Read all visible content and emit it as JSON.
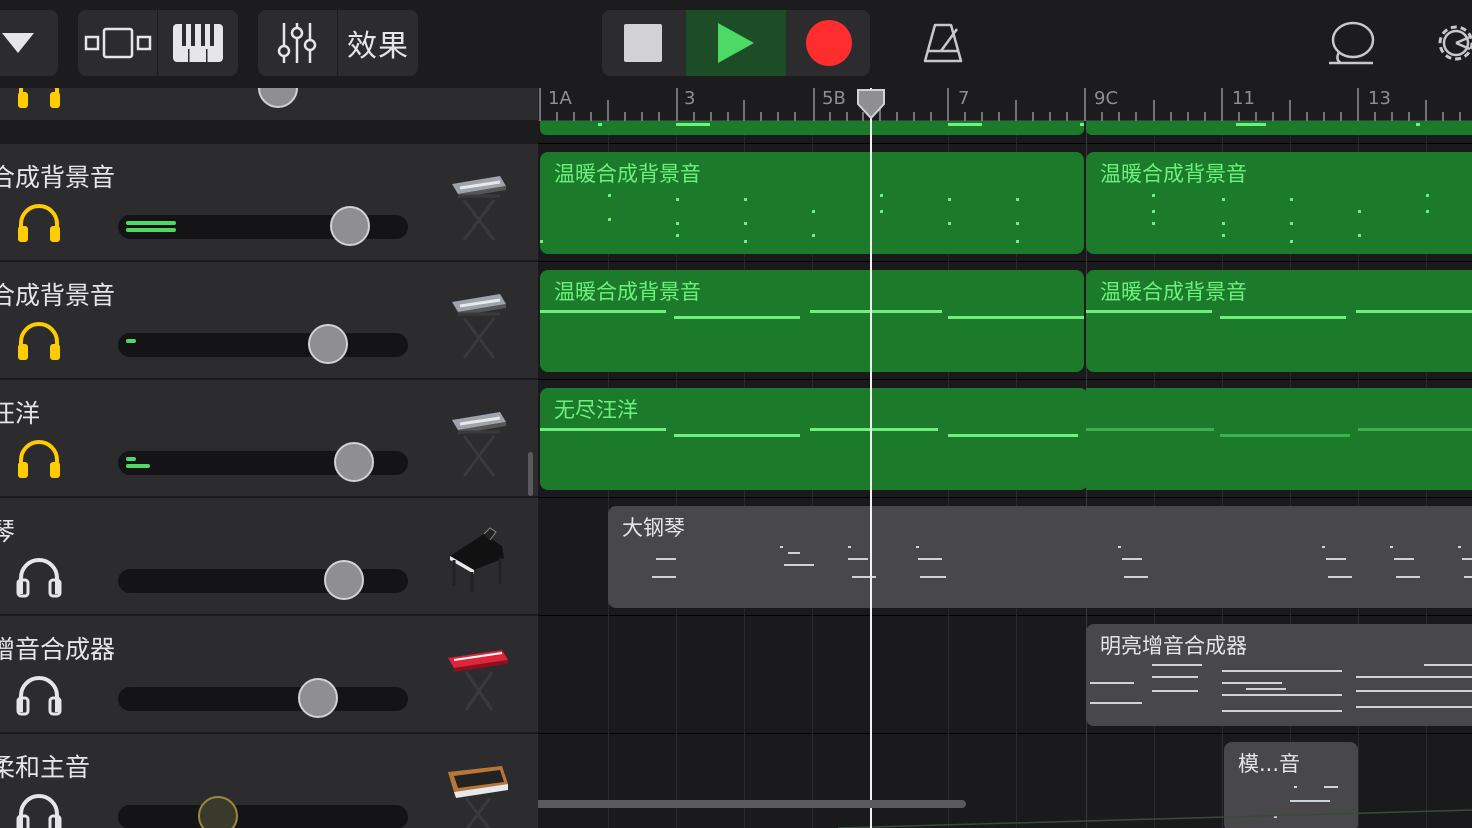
{
  "toolbar": {
    "fx_label": "效果"
  },
  "ruler": {
    "markers": [
      "1A",
      "3",
      "5B",
      "7",
      "9C",
      "11",
      "13"
    ]
  },
  "tracks": [
    {
      "name": "",
      "solo_active": true,
      "volume": 0.5,
      "meter": 0.0,
      "instrument": "keyboard-stand-icon"
    },
    {
      "name": "合成背景音",
      "solo_active": true,
      "volume": 0.8,
      "meter": 0.2,
      "instrument": "keyboard-stand-icon"
    },
    {
      "name": "合成背景音",
      "solo_active": true,
      "volume": 0.72,
      "meter": 0.04,
      "instrument": "keyboard-stand-icon"
    },
    {
      "name": "汪洋",
      "solo_active": true,
      "volume": 0.82,
      "meter": 0.1,
      "instrument": "keyboard-stand-icon"
    },
    {
      "name": "琴",
      "solo_active": false,
      "volume": 0.78,
      "meter": 0.0,
      "instrument": "grand-piano-icon"
    },
    {
      "name": "增音合成器",
      "solo_active": false,
      "volume": 0.69,
      "meter": 0.0,
      "instrument": "red-synth-icon"
    },
    {
      "name": "柔和主音",
      "solo_active": false,
      "volume": 0.34,
      "meter": 0.0,
      "instrument": "analog-synth-icon"
    }
  ],
  "regions": {
    "r1": "温暖合成背景音",
    "r2": "温暖合成背景音",
    "r3": "温暖合成背景音",
    "r4": "温暖合成背景音",
    "r5": "无尽汪洋",
    "r6": "大钢琴",
    "r7": "明亮增音合成器",
    "r8": "模...音"
  },
  "colors": {
    "accent_green": "#1b7b2b",
    "note_green": "#6ff07e",
    "solo_yellow": "#ffcc00",
    "record_red": "#ff2d2d"
  }
}
